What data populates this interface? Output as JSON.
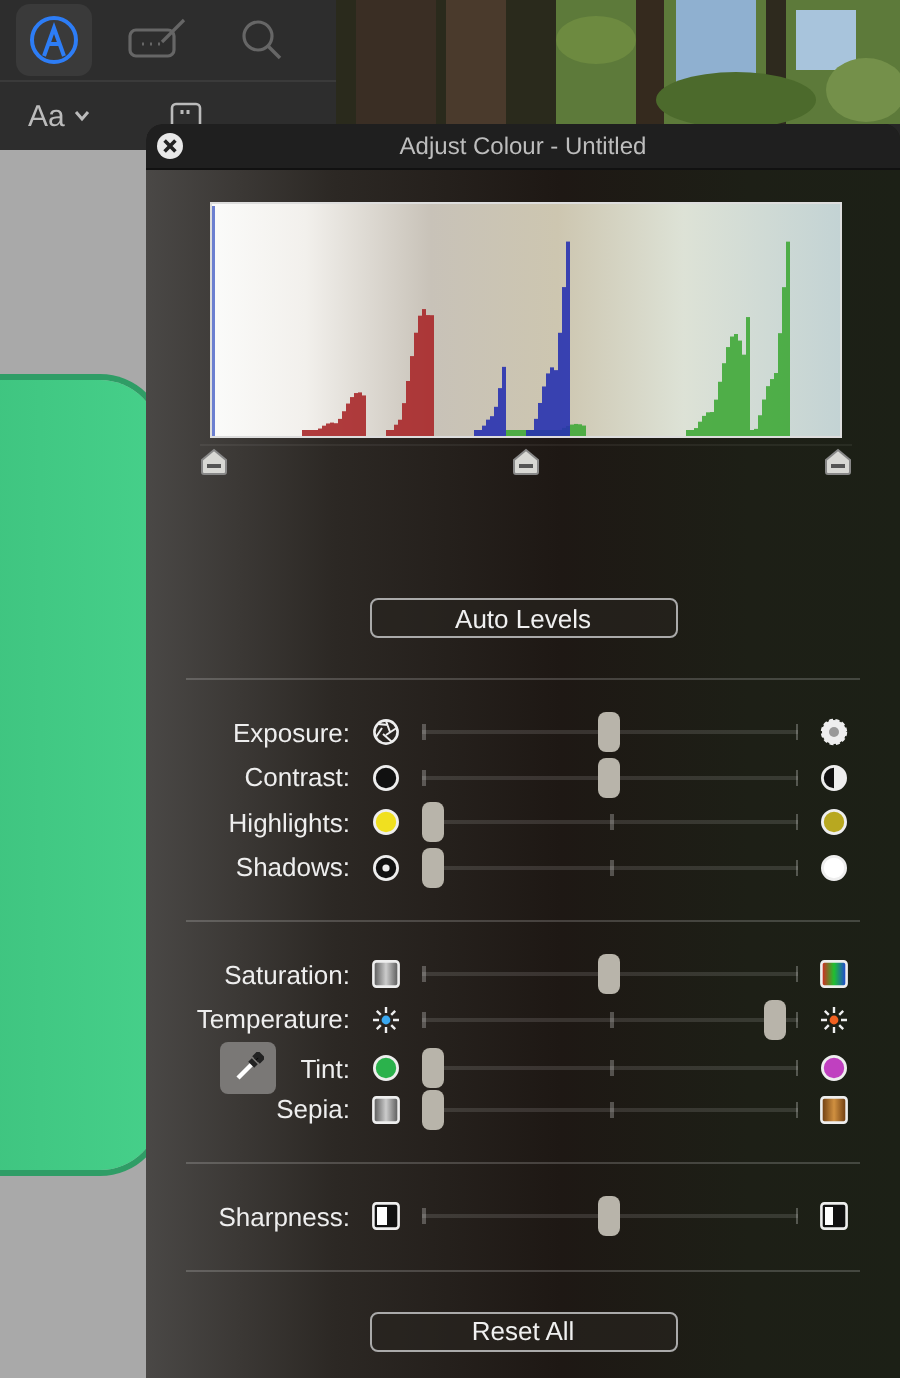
{
  "toolbar": [
    {
      "selected": true
    },
    {
      "selected": false
    },
    {
      "selected": false
    }
  ],
  "format": {
    "font_button": "Aa"
  },
  "window": {
    "title": "Adjust Colour - Untitled"
  },
  "histogram": {
    "markers": [
      {
        "level": 0
      },
      {
        "level": 0.5
      },
      {
        "level": 1
      }
    ]
  },
  "auto_levels": "Auto Levels",
  "groups": [
    [
      {
        "label": "Exposure:",
        "kind": "exposure",
        "level": 0.5
      },
      {
        "label": "Contrast:",
        "kind": "contrast",
        "level": 0.5
      },
      {
        "label": "Highlights:",
        "kind": "highlights",
        "level": 0
      },
      {
        "label": "Shadows:",
        "kind": "shadows",
        "level": 0
      }
    ],
    [
      {
        "label": "Saturation:",
        "kind": "saturation",
        "level": 0.5
      },
      {
        "label": "Temperature:",
        "kind": "temperature",
        "level": 0.97
      },
      {
        "label": "Tint:",
        "kind": "tint",
        "level": 0
      },
      {
        "label": "Sepia:",
        "kind": "sepia",
        "level": 0
      }
    ],
    [
      {
        "label": "Sharpness:",
        "kind": "sharpness",
        "level": 0.5
      }
    ]
  ],
  "reset": "Reset All"
}
